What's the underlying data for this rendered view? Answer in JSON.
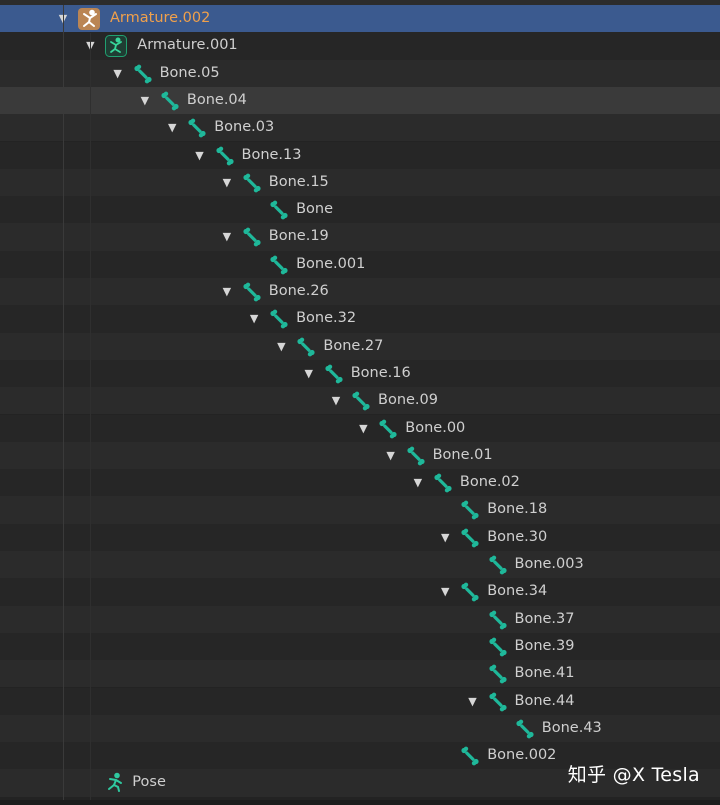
{
  "colors": {
    "selected_row": "#3b5a8f",
    "hover_row": "#3a3a3a",
    "row_even": "#2b2b2b",
    "row_odd": "#262626",
    "bone_icon": "#1fb89a",
    "armature_orange": "#e08a3a",
    "armature_green": "#20a070"
  },
  "outliner": {
    "rows": [
      {
        "label": "Armature.002",
        "depth": 0,
        "icon": "armature-object-icon",
        "expanded": true,
        "state": "selected"
      },
      {
        "label": "Armature.001",
        "depth": 1,
        "icon": "armature-data-icon",
        "expanded": true,
        "state": ""
      },
      {
        "label": "Bone.05",
        "depth": 2,
        "icon": "bone-icon",
        "expanded": true,
        "state": ""
      },
      {
        "label": "Bone.04",
        "depth": 3,
        "icon": "bone-icon",
        "expanded": true,
        "state": "hover"
      },
      {
        "label": "Bone.03",
        "depth": 4,
        "icon": "bone-icon",
        "expanded": true,
        "state": ""
      },
      {
        "label": "Bone.13",
        "depth": 5,
        "icon": "bone-icon",
        "expanded": true,
        "state": ""
      },
      {
        "label": "Bone.15",
        "depth": 6,
        "icon": "bone-icon",
        "expanded": true,
        "state": ""
      },
      {
        "label": "Bone",
        "depth": 7,
        "icon": "bone-icon",
        "expanded": null,
        "state": ""
      },
      {
        "label": "Bone.19",
        "depth": 6,
        "icon": "bone-icon",
        "expanded": true,
        "state": ""
      },
      {
        "label": "Bone.001",
        "depth": 7,
        "icon": "bone-icon",
        "expanded": null,
        "state": ""
      },
      {
        "label": "Bone.26",
        "depth": 6,
        "icon": "bone-icon",
        "expanded": true,
        "state": ""
      },
      {
        "label": "Bone.32",
        "depth": 7,
        "icon": "bone-icon",
        "expanded": true,
        "state": ""
      },
      {
        "label": "Bone.27",
        "depth": 8,
        "icon": "bone-icon",
        "expanded": true,
        "state": ""
      },
      {
        "label": "Bone.16",
        "depth": 9,
        "icon": "bone-icon",
        "expanded": true,
        "state": ""
      },
      {
        "label": "Bone.09",
        "depth": 10,
        "icon": "bone-icon",
        "expanded": true,
        "state": ""
      },
      {
        "label": "Bone.00",
        "depth": 11,
        "icon": "bone-icon",
        "expanded": true,
        "state": ""
      },
      {
        "label": "Bone.01",
        "depth": 12,
        "icon": "bone-icon",
        "expanded": true,
        "state": ""
      },
      {
        "label": "Bone.02",
        "depth": 13,
        "icon": "bone-icon",
        "expanded": true,
        "state": ""
      },
      {
        "label": "Bone.18",
        "depth": 14,
        "icon": "bone-icon",
        "expanded": null,
        "state": ""
      },
      {
        "label": "Bone.30",
        "depth": 14,
        "icon": "bone-icon",
        "expanded": true,
        "state": ""
      },
      {
        "label": "Bone.003",
        "depth": 15,
        "icon": "bone-icon",
        "expanded": null,
        "state": ""
      },
      {
        "label": "Bone.34",
        "depth": 14,
        "icon": "bone-icon",
        "expanded": true,
        "state": ""
      },
      {
        "label": "Bone.37",
        "depth": 15,
        "icon": "bone-icon",
        "expanded": null,
        "state": ""
      },
      {
        "label": "Bone.39",
        "depth": 15,
        "icon": "bone-icon",
        "expanded": null,
        "state": ""
      },
      {
        "label": "Bone.41",
        "depth": 15,
        "icon": "bone-icon",
        "expanded": null,
        "state": ""
      },
      {
        "label": "Bone.44",
        "depth": 15,
        "icon": "bone-icon",
        "expanded": true,
        "state": ""
      },
      {
        "label": "Bone.43",
        "depth": 16,
        "icon": "bone-icon",
        "expanded": null,
        "state": ""
      },
      {
        "label": "Bone.002",
        "depth": 14,
        "icon": "bone-icon",
        "expanded": null,
        "state": ""
      },
      {
        "label": "Pose",
        "depth": 1,
        "icon": "pose-icon",
        "expanded": null,
        "state": ""
      }
    ]
  },
  "watermark": {
    "text": "知乎 @X Tesla"
  }
}
